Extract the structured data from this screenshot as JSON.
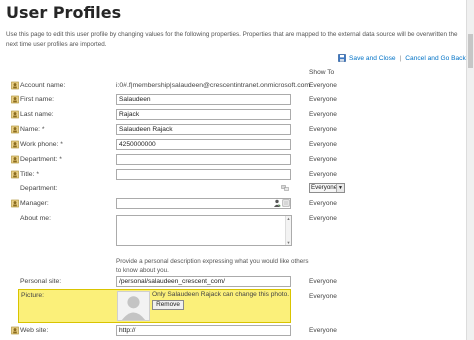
{
  "page": {
    "title": "User Profiles",
    "description": "Use this page to edit this user profile by changing values for the following properties. Properties that are mapped to the external data source will be overwritten the next time user profiles are imported."
  },
  "actions": {
    "save_label": "Save and Close",
    "separator": "|",
    "cancel_label": "Cancel and Go Back"
  },
  "show_to_header": "Show To",
  "fields": {
    "account": {
      "label": "Account name:",
      "value": "i:0#.f|membership|salaudeen@crescentintranet.onmicrosoft.com",
      "visibility": "Everyone"
    },
    "first_name": {
      "label": "First name:",
      "value": "Salaudeen",
      "visibility": "Everyone"
    },
    "last_name": {
      "label": "Last name:",
      "value": "Rajack",
      "visibility": "Everyone"
    },
    "name": {
      "label": "Name: *",
      "value": "Salaudeen Rajack",
      "visibility": "Everyone"
    },
    "work_phone": {
      "label": "Work phone: *",
      "value": "4250000000",
      "visibility": "Everyone"
    },
    "department_req": {
      "label": "Department: *",
      "value": "",
      "visibility": "Everyone"
    },
    "title": {
      "label": "Title: *",
      "value": "",
      "visibility": "Everyone"
    },
    "department": {
      "label": "Department:",
      "visibility_select": "Everyone"
    },
    "manager": {
      "label": "Manager:",
      "value": "",
      "visibility": "Everyone"
    },
    "about_me": {
      "label": "About me:",
      "hint": "Provide a personal description expressing what you would like others to know about you.",
      "visibility": "Everyone"
    },
    "personal_site": {
      "label": "Personal site:",
      "value": "/personal/salaudeen_crescent_com/",
      "visibility": "Everyone"
    },
    "picture": {
      "label": "Picture:",
      "note": "Only Salaudeen Rajack can change this photo.",
      "remove_label": "Remove",
      "visibility": "Everyone"
    },
    "web_site": {
      "label": "Web site:",
      "value": "http://",
      "visibility": "Everyone"
    }
  },
  "colors": {
    "link": "#0072c6",
    "highlight": "#fbf07a",
    "text": "#444444"
  },
  "icons": {
    "save": "save-icon",
    "property": "property-icon",
    "people_picker": "people-picker-icon",
    "address_book": "address-book-icon",
    "department_picker": "department-picker-icon"
  }
}
